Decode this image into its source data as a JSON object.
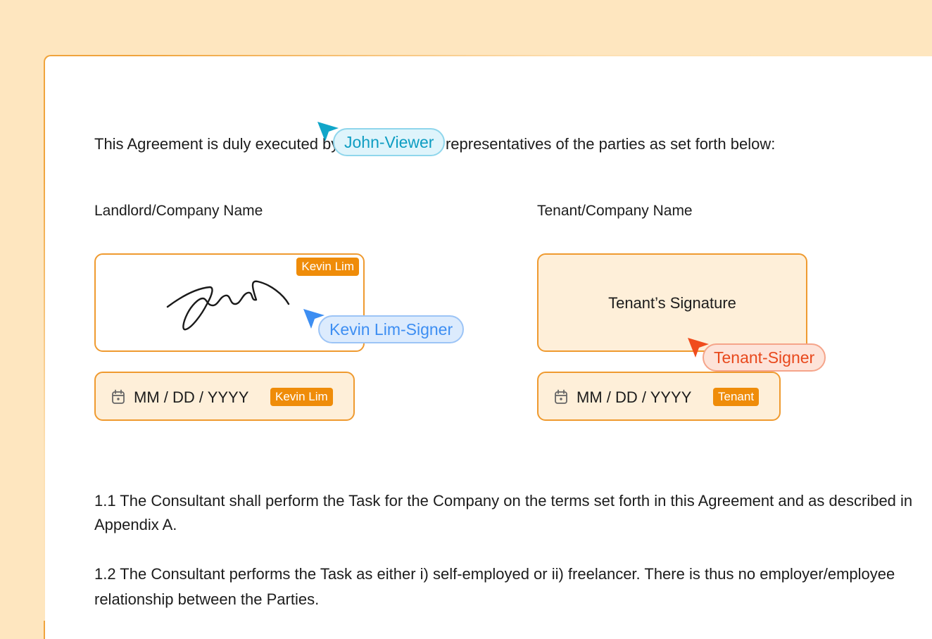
{
  "intro_text": "This Agreement is duly executed by the authorized representatives of the parties as set forth below:",
  "landlord": {
    "heading": "Landlord/Company Name",
    "signer_badge": "Kevin Lim",
    "date_placeholder": "MM / DD / YYYY",
    "date_badge": "Kevin Lim"
  },
  "tenant": {
    "heading": "Tenant/Company Name",
    "signature_placeholder": "Tenant’s Signature",
    "date_placeholder": "MM / DD / YYYY",
    "date_badge": "Tenant"
  },
  "cursors": {
    "john": {
      "label": "John-Viewer",
      "color": "#11a6c9"
    },
    "kevin": {
      "label": "Kevin Lim-Signer",
      "color": "#3d8ef2"
    },
    "tenant": {
      "label": "Tenant-Signer",
      "color": "#f04c1d"
    }
  },
  "clauses": {
    "c1_line1": "1.1 The Consultant shall perform the Task for the Company on the terms set forth in this Agreement and as described in",
    "c1_line2": "Appendix A.",
    "c2_line1": "1.2 The Consultant performs the Task as either i) self-employed or ii) freelancer. There is thus no employer/employee",
    "c2_line2": "relationship between the Parties."
  },
  "colors": {
    "background": "#fee6bf",
    "accent_orange": "#ef8c09",
    "field_fill": "#feefd9"
  }
}
